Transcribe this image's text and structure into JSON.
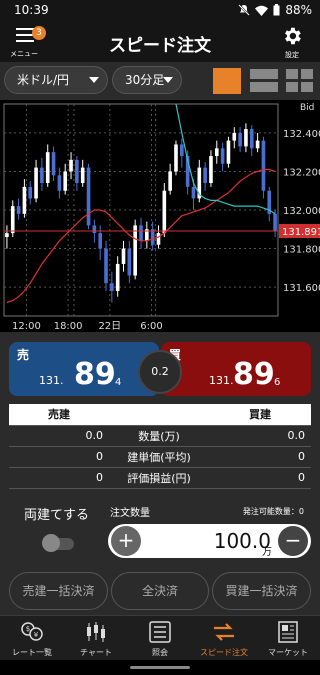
{
  "status": {
    "time": "10:39",
    "battery": "88%"
  },
  "header": {
    "title": "スピード注文",
    "menu_label": "メニュー",
    "menu_badge": "3",
    "settings_label": "設定"
  },
  "toolbar": {
    "pair": "米ドル/円",
    "timeframe": "30分足",
    "accent": "#e8822a"
  },
  "chart_data": {
    "type": "candlestick",
    "label": "Bid",
    "ylim": [
      131.45,
      132.55
    ],
    "y_ticks": [
      "132.400",
      "132.200",
      "132.000",
      "131.800",
      "131.600"
    ],
    "y_tick_values": [
      132.4,
      132.2,
      132.0,
      131.8,
      131.6
    ],
    "x_ticks": [
      "12:00",
      "18:00",
      "22日",
      "6:00"
    ],
    "current_price": "131.891",
    "current_price_value": 131.891,
    "candles": [
      [
        131.86,
        131.88,
        131.8,
        131.92
      ],
      [
        131.88,
        132.02,
        131.86,
        132.05
      ],
      [
        132.02,
        131.98,
        131.95,
        132.06
      ],
      [
        131.98,
        132.12,
        131.96,
        132.16
      ],
      [
        132.12,
        132.06,
        132.03,
        132.15
      ],
      [
        132.06,
        132.22,
        132.04,
        132.26
      ],
      [
        132.22,
        132.14,
        132.1,
        132.27
      ],
      [
        132.14,
        132.3,
        132.12,
        132.34
      ],
      [
        132.3,
        132.18,
        132.15,
        132.33
      ],
      [
        132.18,
        132.1,
        132.06,
        132.22
      ],
      [
        132.1,
        132.2,
        132.08,
        132.24
      ],
      [
        132.2,
        132.26,
        132.16,
        132.3
      ],
      [
        132.26,
        132.14,
        132.1,
        132.28
      ],
      [
        132.14,
        132.22,
        132.12,
        132.26
      ],
      [
        132.22,
        131.92,
        131.9,
        132.24
      ],
      [
        131.92,
        131.88,
        131.83,
        131.95
      ],
      [
        131.88,
        131.8,
        131.74,
        131.92
      ],
      [
        131.8,
        131.62,
        131.58,
        131.84
      ],
      [
        131.62,
        131.58,
        131.52,
        131.68
      ],
      [
        131.58,
        131.72,
        131.55,
        131.76
      ],
      [
        131.72,
        131.8,
        131.68,
        131.84
      ],
      [
        131.8,
        131.66,
        131.62,
        131.84
      ],
      [
        131.66,
        131.92,
        131.64,
        131.95
      ],
      [
        131.92,
        131.84,
        131.8,
        131.96
      ],
      [
        131.84,
        131.9,
        131.8,
        131.94
      ],
      [
        131.9,
        131.82,
        131.79,
        131.94
      ],
      [
        131.82,
        131.88,
        131.8,
        131.92
      ],
      [
        131.88,
        132.1,
        131.86,
        132.14
      ],
      [
        132.1,
        132.2,
        132.08,
        132.24
      ],
      [
        132.2,
        132.34,
        132.18,
        132.36
      ],
      [
        132.34,
        132.28,
        132.22,
        132.37
      ],
      [
        132.28,
        132.12,
        132.08,
        132.31
      ],
      [
        132.12,
        132.06,
        132.0,
        132.16
      ],
      [
        132.06,
        132.22,
        132.04,
        132.26
      ],
      [
        132.22,
        132.14,
        132.1,
        132.25
      ],
      [
        132.14,
        132.28,
        132.12,
        132.31
      ],
      [
        132.28,
        132.32,
        132.24,
        132.36
      ],
      [
        132.32,
        132.24,
        132.2,
        132.35
      ],
      [
        132.24,
        132.36,
        132.22,
        132.38
      ],
      [
        132.36,
        132.4,
        132.32,
        132.43
      ],
      [
        132.4,
        132.33,
        132.3,
        132.43
      ],
      [
        132.33,
        132.42,
        132.3,
        132.45
      ],
      [
        132.42,
        132.32,
        132.28,
        132.44
      ],
      [
        132.32,
        132.36,
        132.3,
        132.4
      ],
      [
        132.36,
        132.1,
        132.06,
        132.38
      ],
      [
        132.1,
        131.98,
        131.94,
        132.12
      ],
      [
        131.98,
        131.89,
        131.86,
        132.0
      ]
    ],
    "ma_red": [
      131.52,
      131.53,
      131.55,
      131.58,
      131.62,
      131.67,
      131.72,
      131.76,
      131.8,
      131.84,
      131.87,
      131.9,
      131.93,
      131.96,
      131.98,
      132.0,
      132.0,
      131.99,
      131.96,
      131.93,
      131.9,
      131.87,
      131.85,
      131.84,
      131.84,
      131.85,
      131.86,
      131.88,
      131.91,
      131.94,
      131.97,
      131.98,
      131.99,
      132.0,
      132.01,
      132.03,
      132.05,
      132.07,
      132.09,
      132.12,
      132.15,
      132.17,
      132.19,
      132.2,
      132.21,
      132.21,
      132.2
    ],
    "ma_cyan": [
      null,
      null,
      null,
      null,
      null,
      null,
      null,
      null,
      null,
      null,
      null,
      null,
      null,
      null,
      null,
      null,
      null,
      null,
      null,
      null,
      null,
      null,
      null,
      null,
      null,
      null,
      null,
      null,
      null,
      132.55,
      132.4,
      132.26,
      132.14,
      132.08,
      132.06,
      132.05,
      132.05,
      132.04,
      132.03,
      132.02,
      132.02,
      132.02,
      132.02,
      132.02,
      132.01,
      132.0,
      131.98
    ]
  },
  "sell": {
    "label": "売",
    "small": "131.",
    "big": "89",
    "pip": "4",
    "color": "#1d4e86"
  },
  "buy": {
    "label": "買",
    "small": "131.",
    "big": "89",
    "pip": "6",
    "color": "#8b0e0e"
  },
  "spread": "0.2",
  "positions": {
    "headers": [
      "売建",
      "",
      "買建"
    ],
    "rows": [
      {
        "left": "0.0",
        "label": "数量(万)",
        "right": "0.0"
      },
      {
        "left": "0",
        "label": "建単価(平均)",
        "right": "0"
      },
      {
        "left": "0",
        "label": "評価損益(円)",
        "right": "0"
      }
    ]
  },
  "order": {
    "hedge_label": "両建てする",
    "qty_label": "注文数量",
    "available": "発注可能数量：0",
    "qty_value": "100.0",
    "qty_unit": "万",
    "plus": "+",
    "minus": "−"
  },
  "settle": {
    "sell": "売建一括決済",
    "all": "全決済",
    "buy": "買建一括決済"
  },
  "tabs": [
    {
      "label": "レート一覧",
      "icon": "rate-list-icon"
    },
    {
      "label": "チャート",
      "icon": "candle-chart-icon"
    },
    {
      "label": "照会",
      "icon": "inquiry-icon"
    },
    {
      "label": "スピード注文",
      "icon": "speed-order-icon"
    },
    {
      "label": "マーケット",
      "icon": "market-news-icon"
    }
  ]
}
